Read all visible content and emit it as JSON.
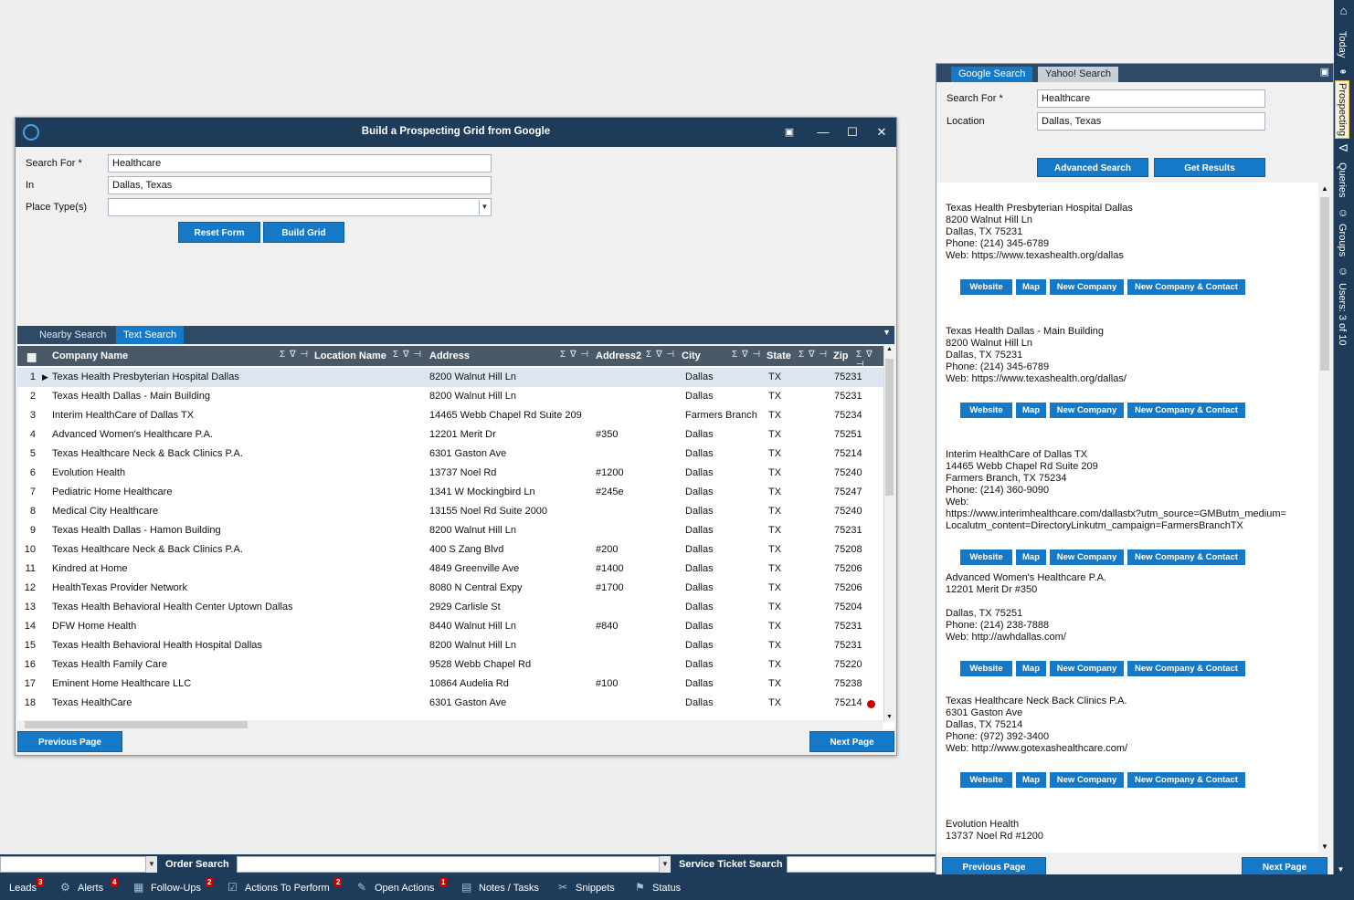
{
  "dialog": {
    "title": "Build a Prospecting Grid from Google",
    "search_for_label": "Search For *",
    "search_for_value": "Healthcare",
    "in_label": "In",
    "in_value": "Dallas, Texas",
    "place_types_label": "Place Type(s)",
    "place_types_value": "",
    "reset_button": "Reset Form",
    "build_button": "Build Grid",
    "tabs": [
      "Nearby Search",
      "Text Search"
    ],
    "active_tab": "Text Search",
    "columns": [
      "Company Name",
      "Location Name",
      "Address",
      "Address2",
      "City",
      "State",
      "Zip"
    ],
    "column_icons": "Σ ∇ ⊣",
    "rows": [
      {
        "n": "1",
        "company": "Texas Health Presbyterian Hospital Dallas",
        "address": "8200 Walnut Hill Ln",
        "address2": "",
        "city": "Dallas",
        "state": "TX",
        "zip": "75231"
      },
      {
        "n": "2",
        "company": "Texas Health Dallas - Main Building",
        "address": "8200 Walnut Hill Ln",
        "address2": "",
        "city": "Dallas",
        "state": "TX",
        "zip": "75231"
      },
      {
        "n": "3",
        "company": "Interim HealthCare of Dallas TX",
        "address": "14465 Webb Chapel Rd Suite 209",
        "address2": "",
        "city": "Farmers Branch",
        "state": "TX",
        "zip": "75234"
      },
      {
        "n": "4",
        "company": "Advanced Women's Healthcare P.A.",
        "address": "12201 Merit Dr",
        "address2": "#350",
        "city": "Dallas",
        "state": "TX",
        "zip": "75251"
      },
      {
        "n": "5",
        "company": "Texas Healthcare Neck & Back Clinics P.A.",
        "address": "6301 Gaston Ave",
        "address2": "",
        "city": "Dallas",
        "state": "TX",
        "zip": "75214"
      },
      {
        "n": "6",
        "company": "Evolution Health",
        "address": "13737 Noel Rd",
        "address2": "#1200",
        "city": "Dallas",
        "state": "TX",
        "zip": "75240"
      },
      {
        "n": "7",
        "company": "Pediatric Home Healthcare",
        "address": "1341 W Mockingbird Ln",
        "address2": "#245e",
        "city": "Dallas",
        "state": "TX",
        "zip": "75247"
      },
      {
        "n": "8",
        "company": "Medical City Healthcare",
        "address": "13155 Noel Rd Suite 2000",
        "address2": "",
        "city": "Dallas",
        "state": "TX",
        "zip": "75240"
      },
      {
        "n": "9",
        "company": "Texas Health Dallas - Hamon Building",
        "address": "8200 Walnut Hill Ln",
        "address2": "",
        "city": "Dallas",
        "state": "TX",
        "zip": "75231"
      },
      {
        "n": "10",
        "company": "Texas Healthcare Neck & Back Clinics P.A.",
        "address": "400 S Zang Blvd",
        "address2": "#200",
        "city": "Dallas",
        "state": "TX",
        "zip": "75208"
      },
      {
        "n": "11",
        "company": "Kindred at Home",
        "address": "4849 Greenville Ave",
        "address2": "#1400",
        "city": "Dallas",
        "state": "TX",
        "zip": "75206"
      },
      {
        "n": "12",
        "company": "HealthTexas Provider Network",
        "address": "8080 N Central Expy",
        "address2": "#1700",
        "city": "Dallas",
        "state": "TX",
        "zip": "75206"
      },
      {
        "n": "13",
        "company": "Texas Health Behavioral Health Center Uptown Dallas",
        "address": "2929 Carlisle St",
        "address2": "",
        "city": "Dallas",
        "state": "TX",
        "zip": "75204"
      },
      {
        "n": "14",
        "company": "DFW Home Health",
        "address": "8440 Walnut Hill Ln",
        "address2": "#840",
        "city": "Dallas",
        "state": "TX",
        "zip": "75231"
      },
      {
        "n": "15",
        "company": "Texas Health Behavioral Health Hospital Dallas",
        "address": "8200 Walnut Hill Ln",
        "address2": "",
        "city": "Dallas",
        "state": "TX",
        "zip": "75231"
      },
      {
        "n": "16",
        "company": "Texas Health Family Care",
        "address": "9528 Webb Chapel Rd",
        "address2": "",
        "city": "Dallas",
        "state": "TX",
        "zip": "75220"
      },
      {
        "n": "17",
        "company": "Eminent Home Healthcare LLC",
        "address": "10864 Audelia Rd",
        "address2": "#100",
        "city": "Dallas",
        "state": "TX",
        "zip": "75238"
      },
      {
        "n": "18",
        "company": "Texas HealthCare",
        "address": "6301 Gaston Ave",
        "address2": "",
        "city": "Dallas",
        "state": "TX",
        "zip": "75214"
      }
    ],
    "prev_button": "Previous Page",
    "next_button": "Next Page"
  },
  "search_panel": {
    "tabs": [
      "Google Search",
      "Yahoo! Search"
    ],
    "search_for_label": "Search For *",
    "search_for_value": "Healthcare",
    "location_label": "Location",
    "location_value": "Dallas, Texas",
    "advanced_button": "Advanced Search",
    "results_button": "Get Results",
    "result_buttons": [
      "Website",
      "Map",
      "New Company",
      "New Company & Contact"
    ],
    "results": [
      {
        "lines": [
          "Texas Health Presbyterian Hospital Dallas",
          "8200 Walnut Hill Ln",
          "Dallas, TX 75231",
          "Phone: (214) 345-6789",
          "Web: https://www.texashealth.org/dallas"
        ]
      },
      {
        "lines": [
          "Texas Health Dallas - Main Building",
          "8200 Walnut Hill Ln",
          "Dallas, TX 75231",
          "Phone: (214) 345-6789",
          "Web: https://www.texashealth.org/dallas/"
        ]
      },
      {
        "lines": [
          "Interim HealthCare of Dallas TX",
          "14465 Webb Chapel Rd Suite 209",
          "Farmers Branch, TX 75234",
          "Phone: (214) 360-9090",
          "Web:",
          "https://www.interimhealthcare.com/dallastx?utm_source=GMButm_medium=",
          "Localutm_content=DirectoryLinkutm_campaign=FarmersBranchTX"
        ]
      },
      {
        "lines": [
          "Advanced Women's Healthcare P.A.",
          "12201 Merit Dr #350",
          "",
          "Dallas, TX 75251",
          "Phone: (214) 238-7888",
          "Web: http://awhdallas.com/"
        ]
      },
      {
        "lines": [
          "Texas Healthcare Neck  Back Clinics P.A.",
          "6301 Gaston Ave",
          "Dallas, TX 75214",
          "Phone: (972) 392-3400",
          "Web: http://www.gotexashealthcare.com/"
        ]
      },
      {
        "lines": [
          "Evolution Health",
          "13737 Noel Rd #1200",
          "",
          "Dallas, TX 75240"
        ]
      }
    ],
    "prev_button": "Previous Page",
    "next_button": "Next Page"
  },
  "side_bar": {
    "items": [
      "Today",
      "Prospecting",
      "Queries",
      "Groups",
      "Users: 3 of 10"
    ],
    "active": "Prospecting"
  },
  "bottom_search": {
    "order_label": "Order Search",
    "ticket_label": "Service Ticket Search"
  },
  "taskbar": {
    "items": [
      {
        "label": "Leads",
        "badge": "3"
      },
      {
        "label": "Alerts",
        "badge": "4"
      },
      {
        "label": "Follow-Ups",
        "badge": "2"
      },
      {
        "label": "Actions To Perform",
        "badge": "2"
      },
      {
        "label": "Open Actions",
        "badge": "1"
      },
      {
        "label": "Notes / Tasks",
        "badge": ""
      },
      {
        "label": "Snippets",
        "badge": ""
      },
      {
        "label": "Status",
        "badge": ""
      }
    ]
  },
  "colors": {
    "navy": "#1e3c5a",
    "accent_blue": "#1679c7",
    "header_gray": "#4a5968",
    "badge_red": "#cc0000"
  }
}
